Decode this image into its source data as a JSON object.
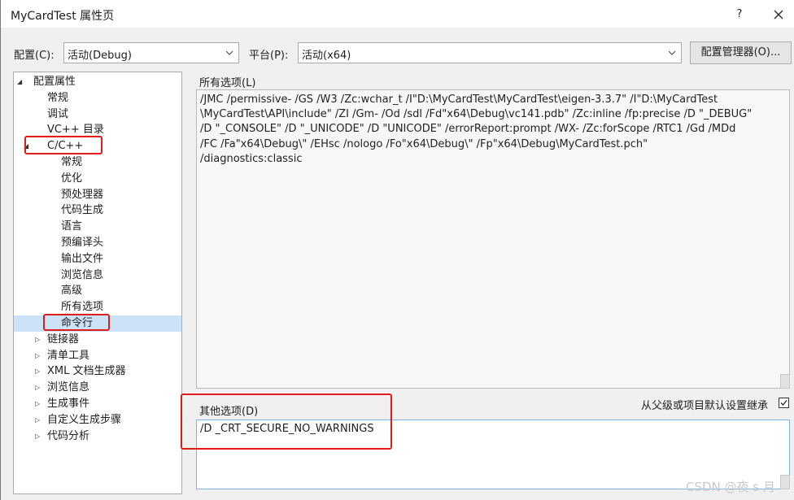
{
  "window": {
    "title": "MyCardTest 属性页",
    "help_label": "?"
  },
  "toolbar": {
    "config_label": "配置(C):",
    "config_value": "活动(Debug)",
    "platform_label": "平台(P):",
    "platform_value": "活动(x64)",
    "manager_button": "配置管理器(O)..."
  },
  "tree": {
    "items": [
      {
        "label": "配置属性",
        "twisty": "◢"
      },
      {
        "label": "常规"
      },
      {
        "label": "调试"
      },
      {
        "label": "VC++ 目录"
      },
      {
        "label": "C/C++",
        "twisty": "◢"
      },
      {
        "label": "常规"
      },
      {
        "label": "优化"
      },
      {
        "label": "预处理器"
      },
      {
        "label": "代码生成"
      },
      {
        "label": "语言"
      },
      {
        "label": "预编译头"
      },
      {
        "label": "输出文件"
      },
      {
        "label": "浏览信息"
      },
      {
        "label": "高级"
      },
      {
        "label": "所有选项"
      },
      {
        "label": "命令行",
        "selected": true
      },
      {
        "label": "链接器",
        "twisty": "▷"
      },
      {
        "label": "清单工具",
        "twisty": "▷"
      },
      {
        "label": "XML 文档生成器",
        "twisty": "▷"
      },
      {
        "label": "浏览信息",
        "twisty": "▷"
      },
      {
        "label": "生成事件",
        "twisty": "▷"
      },
      {
        "label": "自定义生成步骤",
        "twisty": "▷"
      },
      {
        "label": "代码分析",
        "twisty": "▷"
      }
    ]
  },
  "all_options": {
    "label": "所有选项(L)",
    "lines": [
      "/JMC /permissive- /GS /W3 /Zc:wchar_t /I\"D:\\MyCardTest\\MyCardTest\\eigen-3.3.7\" /I\"D:\\MyCardTest",
      "\\MyCardTest\\API\\include\" /ZI /Gm- /Od /sdl /Fd\"x64\\Debug\\vc141.pdb\" /Zc:inline /fp:precise /D \"_DEBUG\"",
      "/D \"_CONSOLE\" /D \"_UNICODE\" /D \"UNICODE\" /errorReport:prompt /WX- /Zc:forScope /RTC1 /Gd /MDd",
      "/FC /Fa\"x64\\Debug\\\" /EHsc /nologo /Fo\"x64\\Debug\\\" /Fp\"x64\\Debug\\MyCardTest.pch\"",
      "/diagnostics:classic"
    ]
  },
  "other_options": {
    "label": "其他选项(D)",
    "value": "/D _CRT_SECURE_NO_WARNINGS",
    "inherit_label": "从父级或项目默认设置继承",
    "inherit_checked": true
  },
  "watermark": "CSDN @夜 s 月",
  "colors": {
    "highlight": "#e01b1b",
    "selection": "#cce2f7",
    "focus_border": "#7eb4ea"
  }
}
